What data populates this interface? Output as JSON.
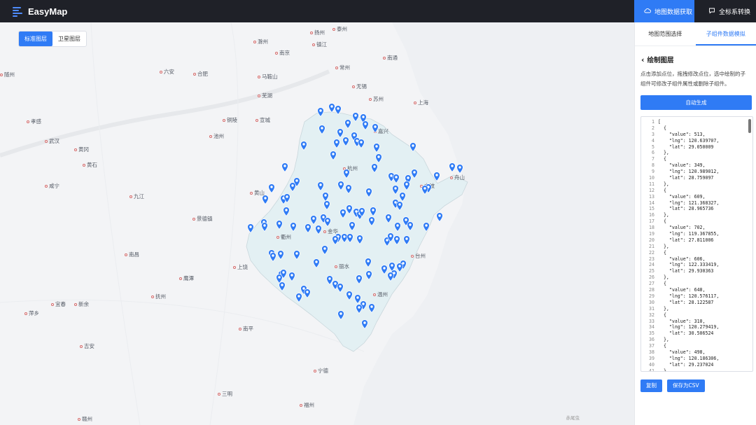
{
  "app": {
    "name": "EasyMap"
  },
  "header": {
    "nav": [
      {
        "label": "地图数据获取",
        "icon": "cloud-upload-icon",
        "active": true
      },
      {
        "label": "全标系转换",
        "icon": "chat-icon",
        "active": false
      }
    ]
  },
  "map": {
    "layers": [
      {
        "label": "标准图层",
        "active": true
      },
      {
        "label": "卫星图层",
        "active": false
      }
    ],
    "watermark": "赤尾虫",
    "cities": [
      {
        "name": "扬州"
      },
      {
        "name": "泰州"
      },
      {
        "name": "滁州"
      },
      {
        "name": "南京"
      },
      {
        "name": "镇江"
      },
      {
        "name": "南通"
      },
      {
        "name": "常州"
      },
      {
        "name": "随州"
      },
      {
        "name": "六安"
      },
      {
        "name": "合肥"
      },
      {
        "name": "马鞍山"
      },
      {
        "name": "无锡"
      },
      {
        "name": "苏州"
      },
      {
        "name": "芜湖"
      },
      {
        "name": "上海"
      },
      {
        "name": "孝感"
      },
      {
        "name": "铜陵"
      },
      {
        "name": "宣城"
      },
      {
        "name": "嘉兴"
      },
      {
        "name": "池州"
      },
      {
        "name": "武汉"
      },
      {
        "name": "黄冈"
      },
      {
        "name": "黄石"
      },
      {
        "name": "杭州"
      },
      {
        "name": "舟山"
      },
      {
        "name": "咸宁"
      },
      {
        "name": "九江"
      },
      {
        "name": "黄山"
      },
      {
        "name": "宁波"
      },
      {
        "name": "景德镇"
      },
      {
        "name": "衢州"
      },
      {
        "name": "金华"
      },
      {
        "name": "南昌"
      },
      {
        "name": "台州"
      },
      {
        "name": "上饶"
      },
      {
        "name": "丽水"
      },
      {
        "name": "鹰潭"
      },
      {
        "name": "抚州"
      },
      {
        "name": "温州"
      },
      {
        "name": "宜春"
      },
      {
        "name": "新余"
      },
      {
        "name": "萍乡"
      },
      {
        "name": "南平"
      },
      {
        "name": "吉安"
      },
      {
        "name": "宁德"
      },
      {
        "name": "三明"
      },
      {
        "name": "福州"
      },
      {
        "name": "赣州"
      }
    ]
  },
  "panel": {
    "tabs": [
      {
        "label": "地图范围选择",
        "active": false
      },
      {
        "label": "子组件数据模拟",
        "active": true
      }
    ],
    "section_title": "绘制图层",
    "description": "点击添加点位，拖拽修改点位，选中绘制的子组件可修改子组件属性或删除子组件。",
    "auto_button": "自动生成",
    "code_lines": [
      "[",
      "  {",
      "    \"value\": 513,",
      "    \"lng\": 120.639707,",
      "    \"lat\": 29.050009",
      "  },",
      "  {",
      "    \"value\": 349,",
      "    \"lng\": 120.989012,",
      "    \"lat\": 28.759097",
      "  },",
      "  {",
      "    \"value\": 609,",
      "    \"lng\": 121.368327,",
      "    \"lat\": 28.965736",
      "  },",
      "  {",
      "    \"value\": 702,",
      "    \"lng\": 119.367855,",
      "    \"lat\": 27.811006",
      "  },",
      "  {",
      "    \"value\": 606,",
      "    \"lng\": 122.333419,",
      "    \"lat\": 29.930363",
      "  },",
      "  {",
      "    \"value\": 648,",
      "    \"lng\": 120.576117,",
      "    \"lat\": 28.122587",
      "  },",
      "  {",
      "    \"value\": 310,",
      "    \"lng\": 120.279419,",
      "    \"lat\": 30.506524",
      "  },",
      "  {",
      "    \"value\": 498,",
      "    \"lng\": 120.186306,",
      "    \"lat\": 29.237024",
      "  },"
    ],
    "copy_button": "复制",
    "save_button": "保存为CSV"
  },
  "colors": {
    "accent": "#2f7bf5",
    "topbar": "#1f2128",
    "region": "#e3f0f3",
    "pin": "#2f7bf5"
  }
}
